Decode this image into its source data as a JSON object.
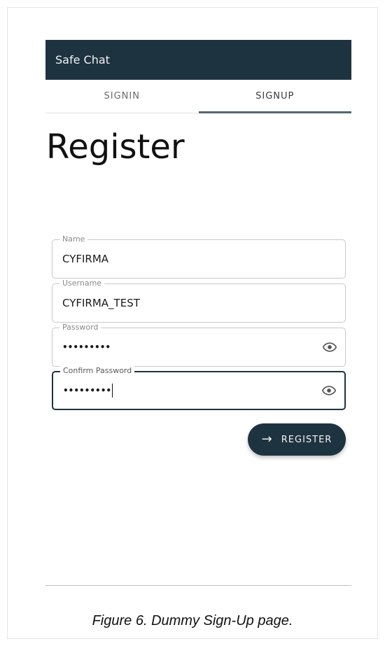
{
  "appbar": {
    "title": "Safe Chat"
  },
  "tabs": [
    {
      "label": "SIGNIN",
      "active": false
    },
    {
      "label": "SIGNUP",
      "active": true
    }
  ],
  "page": {
    "title": "Register"
  },
  "form": {
    "name": {
      "label": "Name",
      "value": "CYFIRMA"
    },
    "username": {
      "label": "Username",
      "value": "CYFIRMA_TEST"
    },
    "password": {
      "label": "Password",
      "value": "•••••••••"
    },
    "confirm_password": {
      "label": "Confirm Password",
      "value": "•••••••••"
    }
  },
  "register_button": {
    "label": "REGISTER",
    "icon": "arrow-right-icon"
  },
  "caption": "Figure 6. Dummy Sign-Up page.",
  "colors": {
    "primary": "#1e3340",
    "tab_indicator": "#546672"
  }
}
